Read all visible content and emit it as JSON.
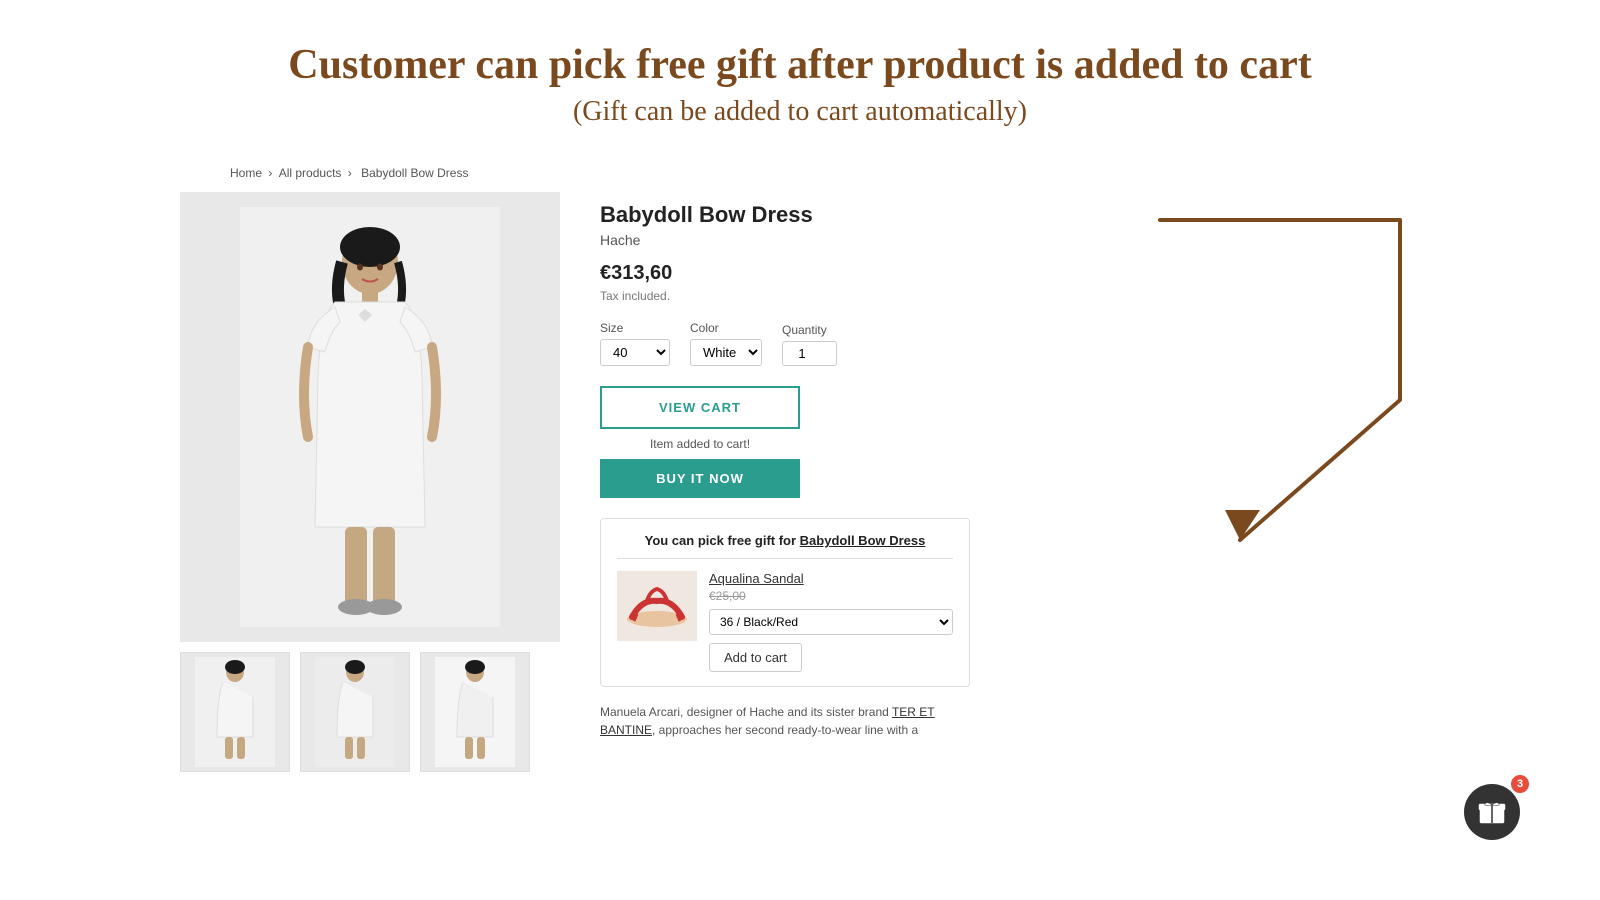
{
  "header": {
    "title": "Customer can pick free gift after product is added to cart",
    "subtitle": "(Gift can be added to cart automatically)"
  },
  "breadcrumb": {
    "home": "Home",
    "allProducts": "All products",
    "product": "Babydoll Bow Dress"
  },
  "product": {
    "name": "Babydoll Bow Dress",
    "brand": "Hache",
    "price": "€313,60",
    "tax": "Tax included.",
    "size_label": "Size",
    "color_label": "Color",
    "quantity_label": "Quantity",
    "size_value": "40",
    "color_value": "White",
    "quantity_value": "1",
    "view_cart_label": "VIEW CART",
    "item_added_text": "Item added to cart!",
    "buy_now_label": "BUY IT NOW"
  },
  "gift": {
    "title_prefix": "You can pick free gift for ",
    "title_link": "Babydoll Bow Dress",
    "product_name": "Aqualina Sandal",
    "product_price": "€25,00",
    "variant": "36 / Black/Red",
    "add_to_cart_label": "Add to cart"
  },
  "description": {
    "text1": "Manuela Arcari, designer of Hache and its sister brand ",
    "link1": "TER ET BANTINE",
    "text2": ", approaches her second ready-to-wear line with a"
  },
  "gift_icon": {
    "badge_count": "3"
  }
}
